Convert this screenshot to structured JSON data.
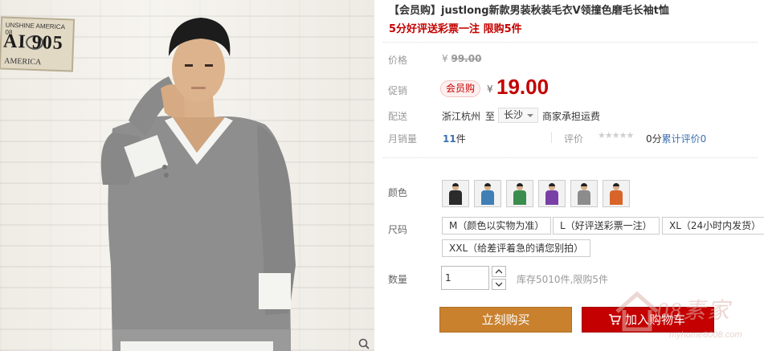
{
  "photo": {
    "plate_top": "UNSHINE AMERICA 08",
    "plate_number": "AI 905",
    "plate_bottom": "AMERICA"
  },
  "product": {
    "title": "【会员购】justlong新款男装秋装毛衣V领撞色磨毛长袖t恤",
    "promo": "5分好评送彩票一注 限购5件"
  },
  "price": {
    "label": "价格",
    "currency": "¥",
    "original": "99.00"
  },
  "promotion": {
    "label": "促销",
    "badge": "会员购",
    "currency": "¥",
    "price": "19.00"
  },
  "shipping": {
    "label": "配送",
    "from": "浙江杭州",
    "to_word": "至",
    "city": "长沙",
    "fee_note": "商家承担运费"
  },
  "sales": {
    "label": "月销量",
    "count": "11",
    "unit": "件",
    "rating_label": "评价",
    "stars": "★★★★★",
    "score_text": "0分",
    "total_text": "累计评价",
    "total_count": "0"
  },
  "color": {
    "label": "颜色",
    "swatches": [
      {
        "name": "black",
        "hex": "#2b2b2b"
      },
      {
        "name": "blue",
        "hex": "#3f7fb5"
      },
      {
        "name": "green",
        "hex": "#3b8d4e"
      },
      {
        "name": "purple",
        "hex": "#7a3fa6"
      },
      {
        "name": "gray",
        "hex": "#8c8c8c"
      },
      {
        "name": "orange",
        "hex": "#d9642a"
      }
    ]
  },
  "size": {
    "label": "尺码",
    "options": [
      "M（颜色以实物为准）",
      "L（好评送彩票一注）",
      "XL（24小时内发货）",
      "XXL（给差评着急的请您别拍）"
    ]
  },
  "quantity": {
    "label": "数量",
    "value": "1",
    "stock_text": "库存5010件,限购5件"
  },
  "actions": {
    "buy_now": "立刻购买",
    "add_cart": "加入购物车"
  },
  "watermark": {
    "text": "08素家",
    "url": "myhome8008.com"
  },
  "colors": {
    "accent_red": "#c40000",
    "buy_button": "#c9812e",
    "link_blue": "#3c6fb0"
  }
}
